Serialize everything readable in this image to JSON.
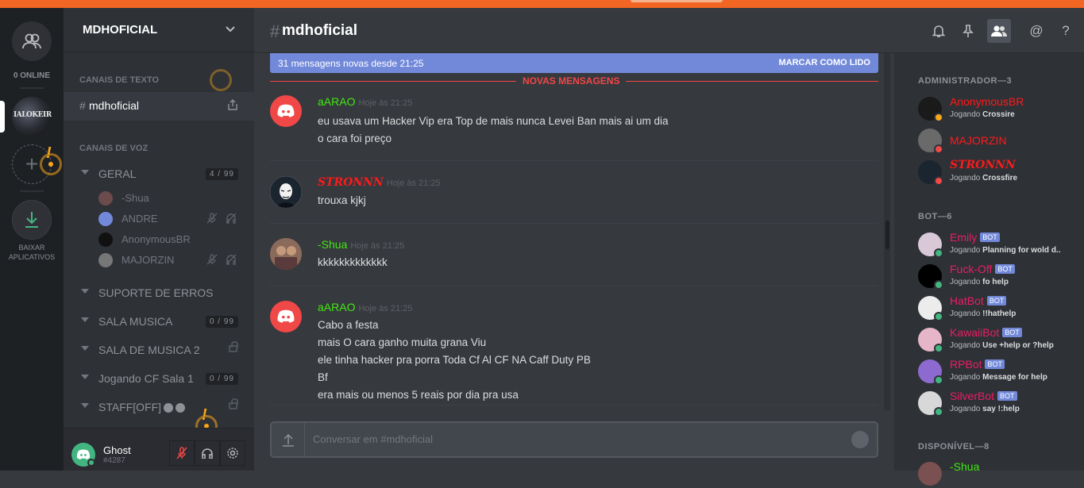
{
  "guilds": {
    "online_count": "0 ONLINE",
    "download_label_1": "BAIXAR",
    "download_label_2": "APLICATIVOS",
    "server_text": "IALOKEIRO",
    "add_symbol": "+"
  },
  "server": {
    "name": "MDHOFICIAL",
    "text_category": "CANAIS DE TEXTO",
    "voice_category": "CANAIS DE VOZ",
    "active_channel": "mdhoficial",
    "voice_channels": [
      {
        "name": "GERAL",
        "count": "4 / 99"
      },
      {
        "name": "SUPORTE DE ERROS",
        "count": ""
      },
      {
        "name": "SALA MUSICA",
        "count": "0 / 99"
      },
      {
        "name": "SALA DE MUSICA 2",
        "count": ""
      },
      {
        "name": "Jogando CF Sala 1",
        "count": "0 / 99"
      },
      {
        "name": "STAFF[OFF]",
        "count": ""
      }
    ],
    "voice_users": [
      "-Shua",
      "ANDRE",
      "AnonymousBR",
      "MAJORZIN"
    ]
  },
  "user": {
    "name": "Ghost",
    "discriminator": "#4287"
  },
  "chat": {
    "channel_hash": "#",
    "channel_name": "mdhoficial",
    "new_messages_banner": "31 mensagens novas desde 21:25",
    "mark_read": "MARCAR COMO LIDO",
    "divider_label": "NOVAS MENSAGENS",
    "composer_placeholder": "Conversar em #mdhoficial",
    "messages": [
      {
        "author": "aARAO",
        "time": "Hoje às 21:25",
        "lines": [
          "eu usava um Hacker Vip era Top de mais nunca Levei Ban mais ai um dia",
          "o cara foi preço"
        ]
      },
      {
        "author": "STRONNN",
        "time": "Hoje às 21:25",
        "lines": [
          "trouxa kjkj"
        ]
      },
      {
        "author": "-Shua",
        "time": "Hoje às 21:25",
        "lines": [
          "kkkkkkkkkkkkk"
        ]
      },
      {
        "author": "aARAO",
        "time": "Hoje às 21:25",
        "lines": [
          "Cabo a festa",
          "mais O cara ganho muita grana Viu",
          "ele tinha hacker pra porra Toda Cf Al CF NA Caff Duty PB",
          "Bf",
          "era mais ou menos 5 reais por dia pra usa"
        ]
      }
    ]
  },
  "members": {
    "admin_header": "ADMINISTRADOR—3",
    "bot_header": "BOT—6",
    "available_header": "DISPONÍVEL—8",
    "bot_tag": "BOT",
    "playing_prefix": "Jogando",
    "admins": [
      {
        "name": "AnonymousBR",
        "game": "Crossire"
      },
      {
        "name": "MAJORZIN",
        "game": ""
      },
      {
        "name": "STRONNN",
        "game": "Crossfire"
      }
    ],
    "bots": [
      {
        "name": "Emily",
        "game": "Planning for wold d..."
      },
      {
        "name": "Fuck-Off",
        "game": "fo help"
      },
      {
        "name": "HatBot",
        "game": "!!hathelp"
      },
      {
        "name": "KawaiiBot",
        "game": "Use +help or ?help"
      },
      {
        "name": "RPBot",
        "game": "Message for help"
      },
      {
        "name": "SilverBot",
        "game": "say !:help"
      }
    ],
    "available_first": "-Shua"
  },
  "colors": {
    "accent_orange": "#f26522",
    "blurple": "#7289da",
    "online": "#43b581",
    "dnd": "#f04747",
    "idle": "#faa61a",
    "author_green": "#43e814",
    "admin_red": "#ff1a1a",
    "bot_pink": "#e91e63"
  }
}
